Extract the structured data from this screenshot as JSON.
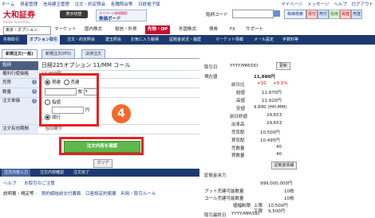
{
  "top_links": [
    "ホーム",
    "資産管理",
    "信用建玉管理",
    "注文・約定照会",
    "各種照会等",
    "日経電子版"
  ],
  "right_links": [
    "マイページ",
    "メッセージ",
    "ヘルプ",
    "ログアウト"
  ],
  "logo": {
    "name": "大和証券",
    "sub": "Daiwa Securities"
  },
  "view_toggle": "表示切替",
  "banner": {
    "small": "マイページ新規開設",
    "title": "株価ボード"
  },
  "code_label": "銘柄コード",
  "header_buttons": [
    "株価検索",
    "買付",
    "売付",
    "信用",
    "買建",
    "売建"
  ],
  "account_select": "東京・オプション",
  "main_nav": [
    "マーケット",
    "国内株式",
    "投信・外貨",
    "先物・OP",
    "外国株式",
    "債券",
    "FX",
    "サポート"
  ],
  "sub_nav": [
    "先物取引",
    "オプション取引",
    "注文・約定照会",
    "建玉照会",
    "お気に入り銘柄",
    "証拠金状況・履歴",
    "マーケット情報",
    "メール設定",
    "手数料等"
  ],
  "tabs": [
    "新規注文(一般)",
    "新規注文(IFD)",
    "決済注文"
  ],
  "order": {
    "symbol_label": "銘柄",
    "symbol_value": "日経225オプション 11/MM コール",
    "strike_label": "権利行使価格",
    "strike_value": "11,000円",
    "side_label": "売買",
    "side_buy": "買建",
    "side_sell": "売建",
    "qty_label": "数量",
    "qty_unit": "枚",
    "price_label": "注文単価",
    "limit": "指値",
    "yen": "円",
    "market": "成行",
    "expiry_label": "注文有効期間",
    "expiry_value": "当日限り",
    "confirm": "注文内容を確認",
    "clear": "クリア"
  },
  "step_badge": "4",
  "steps": [
    "注文内容入力",
    "注文内容確認",
    "注文完了"
  ],
  "help_links": [
    "ヘルプ",
    "お取引のご注意"
  ],
  "docs_label": "説明書・規定等 :",
  "doc_links": [
    "契約締結前交付書面",
    "口座設定約諾書",
    "利用・取引ルール"
  ],
  "quote": {
    "time_label": "取引日",
    "date": "YYYY/MM/DD",
    "update": "更新",
    "current_label": "現在値",
    "current_value": "11,880円",
    "change_label": "前日比",
    "change_value": "+10",
    "change_pct": "+0.1%",
    "rows": [
      {
        "k": "始値",
        "v": "11,870円"
      },
      {
        "k": "高値",
        "v": "11,920円"
      },
      {
        "k": "安値",
        "v": "9,890 (HH:MM)"
      },
      {
        "k": "前日終値",
        "v": "29,653"
      },
      {
        "k": "出来高",
        "v": "29,653"
      },
      {
        "k": "売気配",
        "v": "10,500円"
      },
      {
        "k": "買気配",
        "v": "10,495円"
      },
      {
        "k": "売数量",
        "v": "40"
      },
      {
        "k": "買数量",
        "v": "40"
      }
    ],
    "margin_btn": "証拠金情報",
    "margin_title": "証拠金余力",
    "margin_value": "999,000,000円",
    "put_label": "プット売建可能数量",
    "put_value": "10枚",
    "call_label": "コール売建可能数量",
    "call_value": "10枚",
    "limit_label": "値幅制限",
    "upper_label": "上限",
    "upper_value": "10,500円",
    "lower_label": "下限",
    "lower_value": "9,500円",
    "last_label": "取引最終日",
    "last_value": "YYYY/MM/DD"
  },
  "colors": {
    "accent": "#c8102e",
    "nav": "#1c3a6f",
    "highlight": "#e8201e",
    "confirm": "#5fb84a",
    "badge": "#f06a2a"
  }
}
